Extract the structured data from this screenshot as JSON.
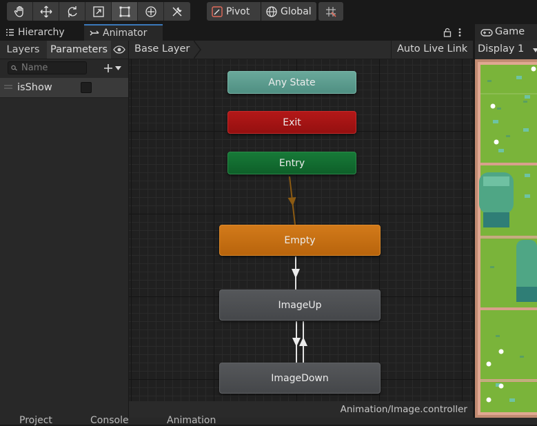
{
  "toolbar": {
    "tools": [
      {
        "icon": "hand-icon",
        "active": false
      },
      {
        "icon": "move-icon",
        "active": false
      },
      {
        "icon": "rotate-icon",
        "active": false
      },
      {
        "icon": "scale-icon",
        "active": false
      },
      {
        "icon": "rect-transform-icon",
        "active": true
      },
      {
        "icon": "transform-icon",
        "active": false
      },
      {
        "icon": "custom-tool-icon",
        "active": false
      }
    ],
    "pivot_label": "Pivot",
    "global_label": "Global"
  },
  "tabs": {
    "hierarchy": "Hierarchy",
    "animator": "Animator",
    "game": "Game"
  },
  "sidebar": {
    "layers_label": "Layers",
    "parameters_label": "Parameters",
    "search_placeholder": "Name",
    "parameters": [
      {
        "name": "isShow",
        "type": "bool",
        "value": false
      }
    ]
  },
  "graph": {
    "breadcrumb": "Base Layer",
    "auto_live_link": "Auto Live Link",
    "states": {
      "any_state": "Any State",
      "exit": "Exit",
      "entry": "Entry",
      "empty": "Empty",
      "image_up": "ImageUp",
      "image_down": "ImageDown"
    },
    "status_path": "Animation/Image.controller",
    "colors": {
      "any_state": "#5a9e8f",
      "exit": "#a21414",
      "entry": "#12682f",
      "empty": "#c56f12",
      "default": "#4b4d50",
      "transition_entry": "#8b5a12",
      "transition": "#e8e8e8"
    }
  },
  "game": {
    "display_label": "Display 1"
  },
  "bottom": {
    "tabs": [
      "Project",
      "Console",
      "Animation"
    ]
  }
}
